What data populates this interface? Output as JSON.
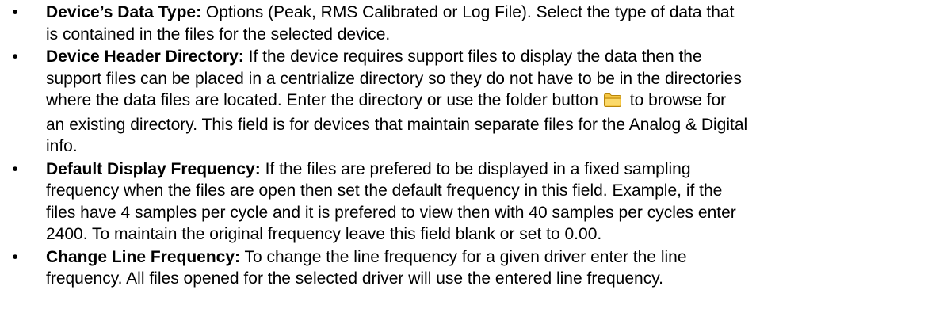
{
  "bullets": [
    {
      "term": "Device’s Data Type:",
      "lines": [
        " Options (Peak, RMS Calibrated or Log File).   Select the type of data that",
        "is contained in the files for the selected device."
      ]
    },
    {
      "term": "Device Header Directory:",
      "lines": [
        " If the device requires support files to display the data then the",
        "support files can be placed in a centrialize directory so they do not have to be in the directories"
      ],
      "line3_before_icon": "where the data files are located. Enter the directory or use the folder button",
      "line3_after_icon": " to browse for",
      "lines_after": [
        "an existing directory. This field is for devices that maintain separate files for the Analog & Digital",
        "info."
      ],
      "icon": "folder-icon"
    },
    {
      "term": "Default Display Frequency:",
      "lines": [
        "  If the files are prefered to be displayed in a fixed sampling",
        "frequency when the files are open then set the default frequency in this field.   Example, if the",
        "files have 4 samples per cycle and it is prefered to view then with 40 samples per cycles enter",
        "2400. To maintain the original frequency leave this field blank or set to 0.00."
      ]
    },
    {
      "term": "Change Line Frequency:",
      "lines": [
        " To change the line frequency for a given driver enter the line",
        "frequency. All files opened for the selected driver will use the entered line frequency."
      ]
    }
  ],
  "bullet_glyph": "•",
  "colors": {
    "text": "#000000",
    "folder_fill": "#f6c744",
    "folder_stroke": "#b8860b"
  }
}
